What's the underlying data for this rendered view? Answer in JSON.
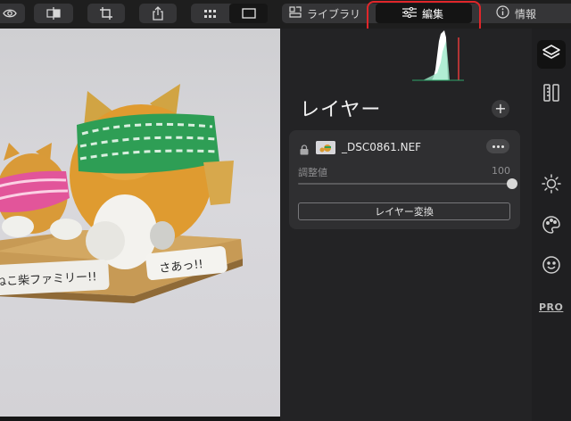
{
  "toolbar": {
    "eye_icon": "eye-icon",
    "compare_icon": "compare-split-icon",
    "crop_icon": "crop-icon",
    "share_icon": "share-icon",
    "grid_icon": "grid-view-icon",
    "single_icon": "single-view-icon",
    "tabs": [
      {
        "label": "ライブラリ",
        "icon": "library-icon"
      },
      {
        "label": "編集",
        "icon": "adjustments-icon",
        "active": true
      },
      {
        "label": "情報",
        "icon": "info-icon"
      }
    ],
    "highlight_color": "#e0262a"
  },
  "photo": {
    "sign_left": "ねこ柴ファミリー!!",
    "sign_right": "さあっ!!"
  },
  "panel": {
    "title": "レイヤー",
    "add_label": "+",
    "layer": {
      "filename": "_DSC0861.NEF",
      "slider_label": "調整値",
      "slider_value": "100",
      "slider_fraction": 1.0,
      "convert_button": "レイヤー変換"
    }
  },
  "sidebar": {
    "items": [
      "layers-icon",
      "ruler-icon",
      "sun-icon",
      "palette-icon",
      "face-icon"
    ],
    "pro_label": "PRO"
  }
}
